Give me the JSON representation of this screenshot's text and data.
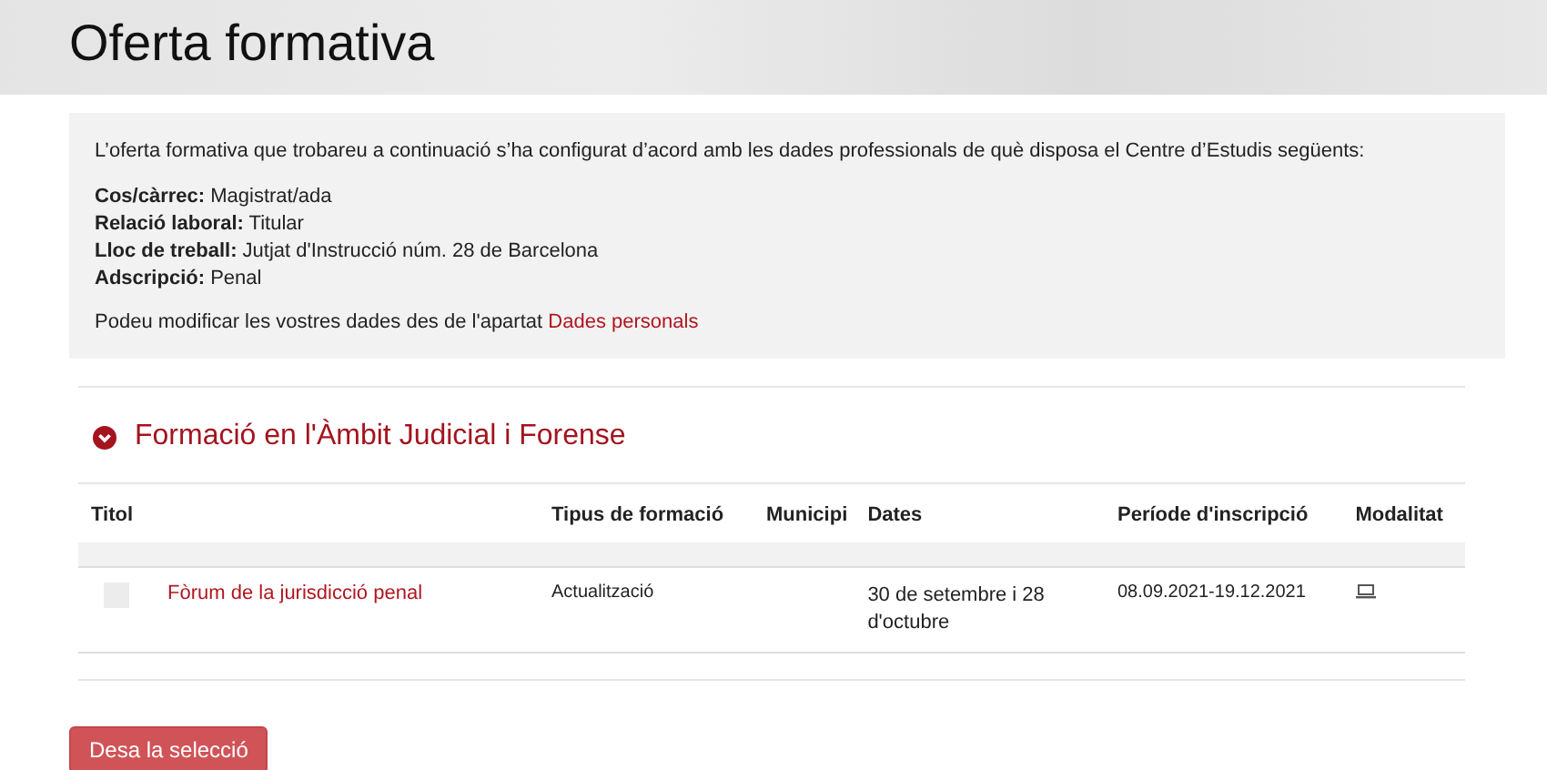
{
  "page_title": "Oferta formativa",
  "info": {
    "intro": "L’oferta formativa que trobareu a continuació s’ha configurat d’acord amb les dades professionals de què disposa el Centre d’Estudis següents:",
    "fields": [
      {
        "label": "Cos/càrrec:",
        "value": "Magistrat/ada"
      },
      {
        "label": "Relació laboral:",
        "value": "Titular"
      },
      {
        "label": "Lloc de treball:",
        "value": "Jutjat d'Instrucció núm. 28 de Barcelona"
      },
      {
        "label": "Adscripció:",
        "value": "Penal"
      }
    ],
    "note": "Podeu modificar les vostres dades des de l'apartat",
    "note_link": "Dades personals"
  },
  "section": {
    "title": "Formació en l'Àmbit Judicial i Forense",
    "expanded": true,
    "table": {
      "columns": [
        "Titol",
        "Tipus de formació",
        "Municipi",
        "Dates",
        "Període d'inscripció",
        "Modalitat"
      ],
      "rows": [
        {
          "selected": false,
          "title": "Fòrum de la jurisdicció penal",
          "type": "Actualització",
          "dates": "30 de setembre i 28 d'octubre",
          "period": "08.09.2021-19.12.2021"
        }
      ]
    }
  },
  "save_button": "Desa la selecció"
}
